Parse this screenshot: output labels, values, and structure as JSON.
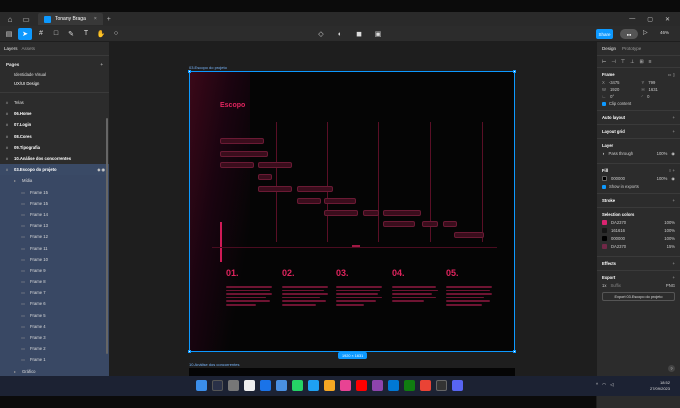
{
  "titlebar": {
    "tab_title": "Tonany Braga",
    "close_glyph": "×",
    "add_glyph": "+"
  },
  "toolbar": {
    "share_label": "Share",
    "zoom": "46%"
  },
  "left_panel": {
    "tab_layers": "Layers",
    "tab_assets": "Assets",
    "page_select": "UX/UI Design",
    "pages_title": "Pages",
    "pages": [
      "Identidade Visual",
      "UX/UI Design"
    ],
    "layers": [
      {
        "name": "Telas",
        "level": 0,
        "bold": false
      },
      {
        "name": "06.Home",
        "level": 0,
        "bold": true
      },
      {
        "name": "07.Login",
        "level": 0,
        "bold": true
      },
      {
        "name": "08.Cores",
        "level": 0,
        "bold": true
      },
      {
        "name": "09.Tipografia",
        "level": 0,
        "bold": true
      },
      {
        "name": "10.Análise dos concorrentes",
        "level": 0,
        "bold": true
      },
      {
        "name": "03.Escopo do projeto",
        "level": 0,
        "bold": true,
        "selected": true
      },
      {
        "name": "Mídia",
        "level": 1
      },
      {
        "name": "Frame 15",
        "level": 2
      },
      {
        "name": "Frame 15",
        "level": 2
      },
      {
        "name": "Frame 14",
        "level": 2
      },
      {
        "name": "Frame 13",
        "level": 2
      },
      {
        "name": "Frame 12",
        "level": 2
      },
      {
        "name": "Frame 11",
        "level": 2
      },
      {
        "name": "Frame 10",
        "level": 2
      },
      {
        "name": "Frame 9",
        "level": 2
      },
      {
        "name": "Frame 8",
        "level": 2
      },
      {
        "name": "Frame 7",
        "level": 2
      },
      {
        "name": "Frame 6",
        "level": 2
      },
      {
        "name": "Frame 5",
        "level": 2
      },
      {
        "name": "Frame 4",
        "level": 2
      },
      {
        "name": "Frame 3",
        "level": 2
      },
      {
        "name": "Frame 2",
        "level": 2
      },
      {
        "name": "Frame 1",
        "level": 2
      },
      {
        "name": "Gráfico",
        "level": 1
      }
    ]
  },
  "canvas": {
    "frame_label": "03.Escopo do projeto",
    "frame2_label": "10.Análise dos concorrentes",
    "dimension_badge": "1920 × 1631",
    "frame_title": "Escopo"
  },
  "right_panel": {
    "tab_design": "Design",
    "tab_prototype": "Prototype",
    "frame": {
      "title": "Frame",
      "x": "-3475",
      "y": "799",
      "w": "1920",
      "h": "1631",
      "rotation": "0°",
      "radius": "0",
      "clip": "Clip content"
    },
    "auto_layout": "Auto layout",
    "layout_grid": "Layout grid",
    "layer": {
      "title": "Layer",
      "mode": "Pass through",
      "opacity": "100%"
    },
    "fill": {
      "title": "Fill",
      "hex": "000000",
      "opacity": "100%",
      "show_exports": "Show in exports"
    },
    "stroke": "Stroke",
    "selection_colors": {
      "title": "Selection colors",
      "items": [
        {
          "hex": "DA2370",
          "pct": "100%",
          "color": "#DA2370"
        },
        {
          "hex": "161616",
          "pct": "100%",
          "color": "#161616"
        },
        {
          "hex": "000000",
          "pct": "100%",
          "color": "#000000"
        },
        {
          "hex": "DA2370",
          "pct": "15%",
          "color": "#DA2370"
        }
      ]
    },
    "effects": "Effects",
    "export": {
      "title": "Export",
      "scale": "1x",
      "suffix": "Suffix",
      "format": "PNG",
      "button": "Export 03.Escopo do projeto"
    }
  },
  "taskbar": {
    "time": "18:52",
    "date": "27/09/2023"
  }
}
